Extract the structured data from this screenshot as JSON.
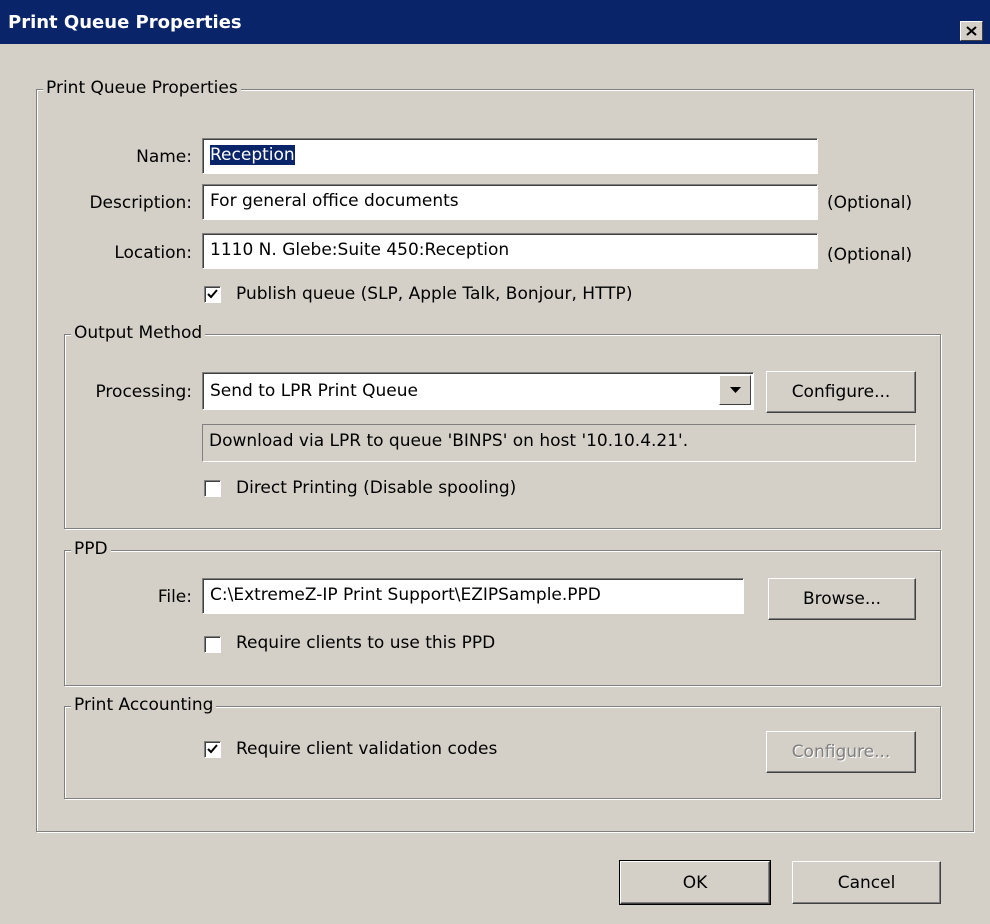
{
  "window": {
    "title": "Print Queue Properties"
  },
  "main_group": {
    "label": "Print Queue Properties"
  },
  "name_field": {
    "label": "Name:",
    "value": "Reception"
  },
  "description_field": {
    "label": "Description:",
    "value": "For general office documents",
    "hint": "(Optional)"
  },
  "location_field": {
    "label": "Location:",
    "value": "1110 N. Glebe:Suite 450:Reception",
    "hint": "(Optional)"
  },
  "publish_queue": {
    "label": "Publish queue (SLP, Apple Talk, Bonjour, HTTP)",
    "checked": true
  },
  "output_method": {
    "label": "Output Method",
    "processing_label": "Processing:",
    "processing_value": "Send to LPR Print Queue",
    "configure_label": "Configure...",
    "info": "Download via LPR to queue 'BINPS' on host '10.10.4.21'.",
    "direct_printing": {
      "label": "Direct Printing (Disable spooling)",
      "checked": false
    }
  },
  "ppd": {
    "label": "PPD",
    "file_label": "File:",
    "file_value": "C:\\ExtremeZ-IP Print Support\\EZIPSample.PPD",
    "browse_label": "Browse...",
    "require_ppd": {
      "label": "Require clients to use this PPD",
      "checked": false
    }
  },
  "print_accounting": {
    "label": "Print Accounting",
    "require_codes": {
      "label": "Require client validation codes",
      "checked": true
    },
    "configure_label": "Configure..."
  },
  "footer": {
    "ok_label": "OK",
    "cancel_label": "Cancel"
  }
}
